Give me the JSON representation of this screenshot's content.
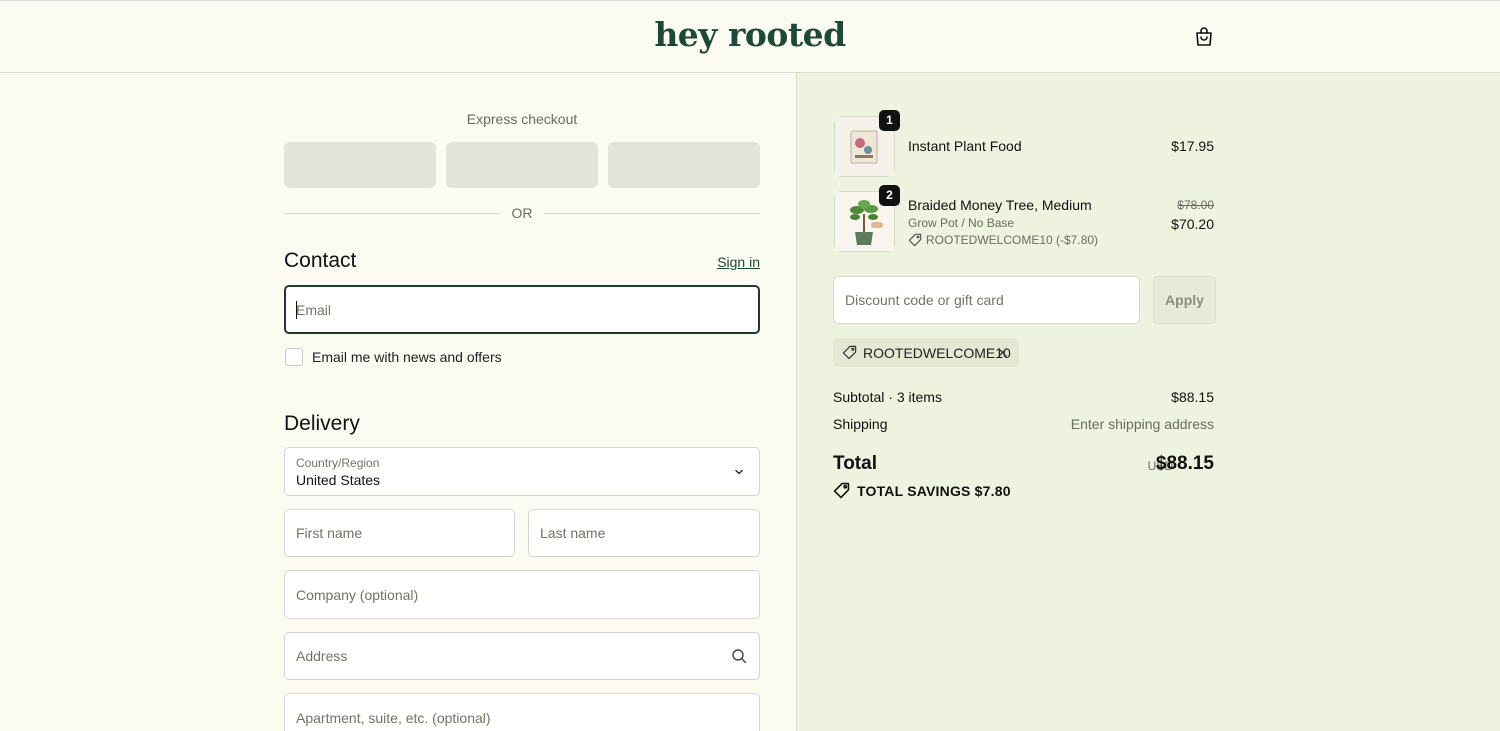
{
  "header": {
    "logo": "hey rooted"
  },
  "express": {
    "label": "Express checkout",
    "or": "OR"
  },
  "contact": {
    "title": "Contact",
    "signin": "Sign in",
    "email_placeholder": "Email",
    "newsletter_label": "Email me with news and offers"
  },
  "delivery": {
    "title": "Delivery",
    "country_label": "Country/Region",
    "country_value": "United States",
    "first_name": "First name",
    "last_name": "Last name",
    "company": "Company (optional)",
    "address": "Address",
    "apartment": "Apartment, suite, etc. (optional)"
  },
  "cart": {
    "items": [
      {
        "qty": "1",
        "name": "Instant Plant Food",
        "price": "$17.95"
      },
      {
        "qty": "2",
        "name": "Braided Money Tree, Medium",
        "variant": "Grow Pot / No Base",
        "discount": "ROOTEDWELCOME10 (-$7.80)",
        "old_price": "$78.00",
        "price": "$70.20"
      }
    ],
    "discount_placeholder": "Discount code or gift card",
    "apply": "Apply",
    "applied_code": "ROOTEDWELCOME10",
    "subtotal_label": "Subtotal · 3 items",
    "subtotal_value": "$88.15",
    "shipping_label": "Shipping",
    "shipping_value": "Enter shipping address",
    "total_label": "Total",
    "currency": "USD",
    "total_value": "$88.15",
    "savings": "TOTAL SAVINGS  $7.80"
  }
}
